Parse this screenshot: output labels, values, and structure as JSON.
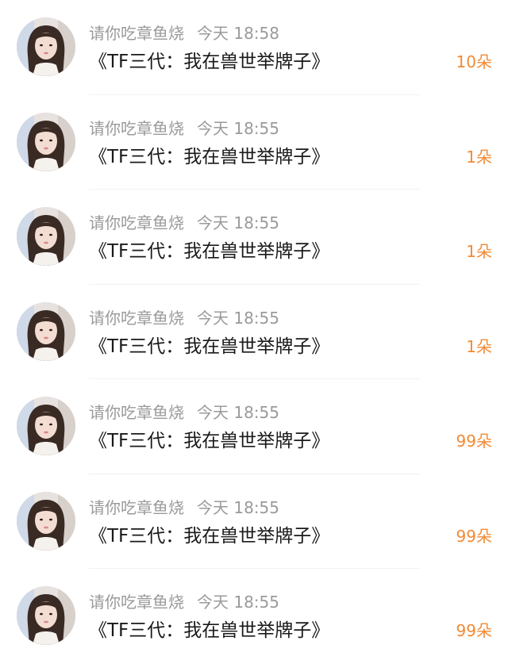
{
  "gift_list": [
    {
      "username": "请你吃章鱼烧",
      "time": "今天 18:58",
      "title": "《TF三代：我在兽世举牌子》",
      "count": "10朵"
    },
    {
      "username": "请你吃章鱼烧",
      "time": "今天 18:55",
      "title": "《TF三代：我在兽世举牌子》",
      "count": "1朵"
    },
    {
      "username": "请你吃章鱼烧",
      "time": "今天 18:55",
      "title": "《TF三代：我在兽世举牌子》",
      "count": "1朵"
    },
    {
      "username": "请你吃章鱼烧",
      "time": "今天 18:55",
      "title": "《TF三代：我在兽世举牌子》",
      "count": "1朵"
    },
    {
      "username": "请你吃章鱼烧",
      "time": "今天 18:55",
      "title": "《TF三代：我在兽世举牌子》",
      "count": "99朵"
    },
    {
      "username": "请你吃章鱼烧",
      "time": "今天 18:55",
      "title": "《TF三代：我在兽世举牌子》",
      "count": "99朵"
    },
    {
      "username": "请你吃章鱼烧",
      "time": "今天 18:55",
      "title": "《TF三代：我在兽世举牌子》",
      "count": "99朵"
    }
  ],
  "colors": {
    "username": "#9a9a9a",
    "title": "#1a1a1a",
    "count": "#f28a33",
    "divider": "#f1f1f1"
  },
  "icons": {
    "avatar": "user-avatar-portrait"
  }
}
